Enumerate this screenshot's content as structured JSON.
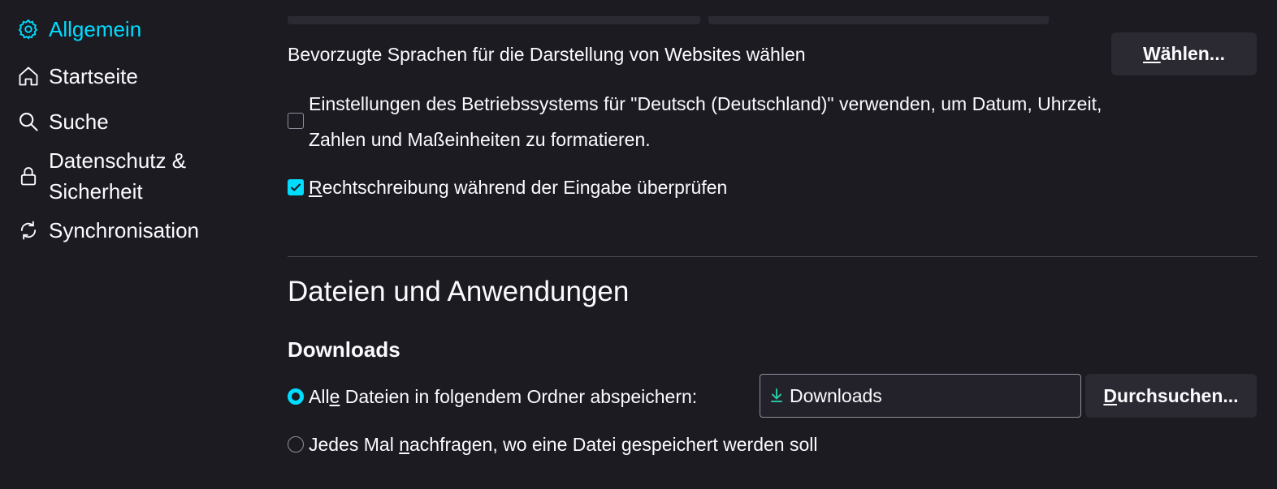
{
  "sidebar": {
    "items": [
      {
        "label": "Allgemein",
        "icon": "gear-icon",
        "active": true
      },
      {
        "label": "Startseite",
        "icon": "home-icon"
      },
      {
        "label": "Suche",
        "icon": "search-icon"
      },
      {
        "label": "Datenschutz &",
        "label2": "Sicherheit",
        "icon": "lock-icon"
      },
      {
        "label": "Synchronisation",
        "icon": "sync-icon"
      }
    ]
  },
  "language": {
    "preferred_text": "Bevorzugte Sprachen für die Darstellung von Websites wählen",
    "choose_button": {
      "prefix": "",
      "accesskey": "W",
      "suffix": "ählen..."
    },
    "os_locale_line1": "Einstellungen des Betriebssystems für \"Deutsch (Deutschland)\" verwenden, um Datum, Uhrzeit,",
    "os_locale_line2": "Zahlen und Maßeinheiten zu formatieren.",
    "os_locale_checked": false,
    "spellcheck": {
      "accesskey": "R",
      "suffix": "echtschreibung während der Eingabe überprüfen",
      "checked": true
    }
  },
  "files": {
    "heading": "Dateien und Anwendungen",
    "downloads_heading": "Downloads",
    "save_all": {
      "prefix": "All",
      "accesskey": "e",
      "suffix": " Dateien in folgendem Ordner abspeichern:",
      "selected": true
    },
    "folder_value": "Downloads",
    "browse_button": {
      "accesskey": "D",
      "suffix": "urchsuchen..."
    },
    "ask_each": {
      "prefix": "Jedes Mal ",
      "accesskey": "n",
      "suffix": "achfragen, wo eine Datei gespeichert werden soll",
      "selected": false
    }
  },
  "colors": {
    "accent": "#00ddff",
    "background": "#1c1b22",
    "button": "#2b2a33",
    "download_icon": "#2ac3a2"
  }
}
